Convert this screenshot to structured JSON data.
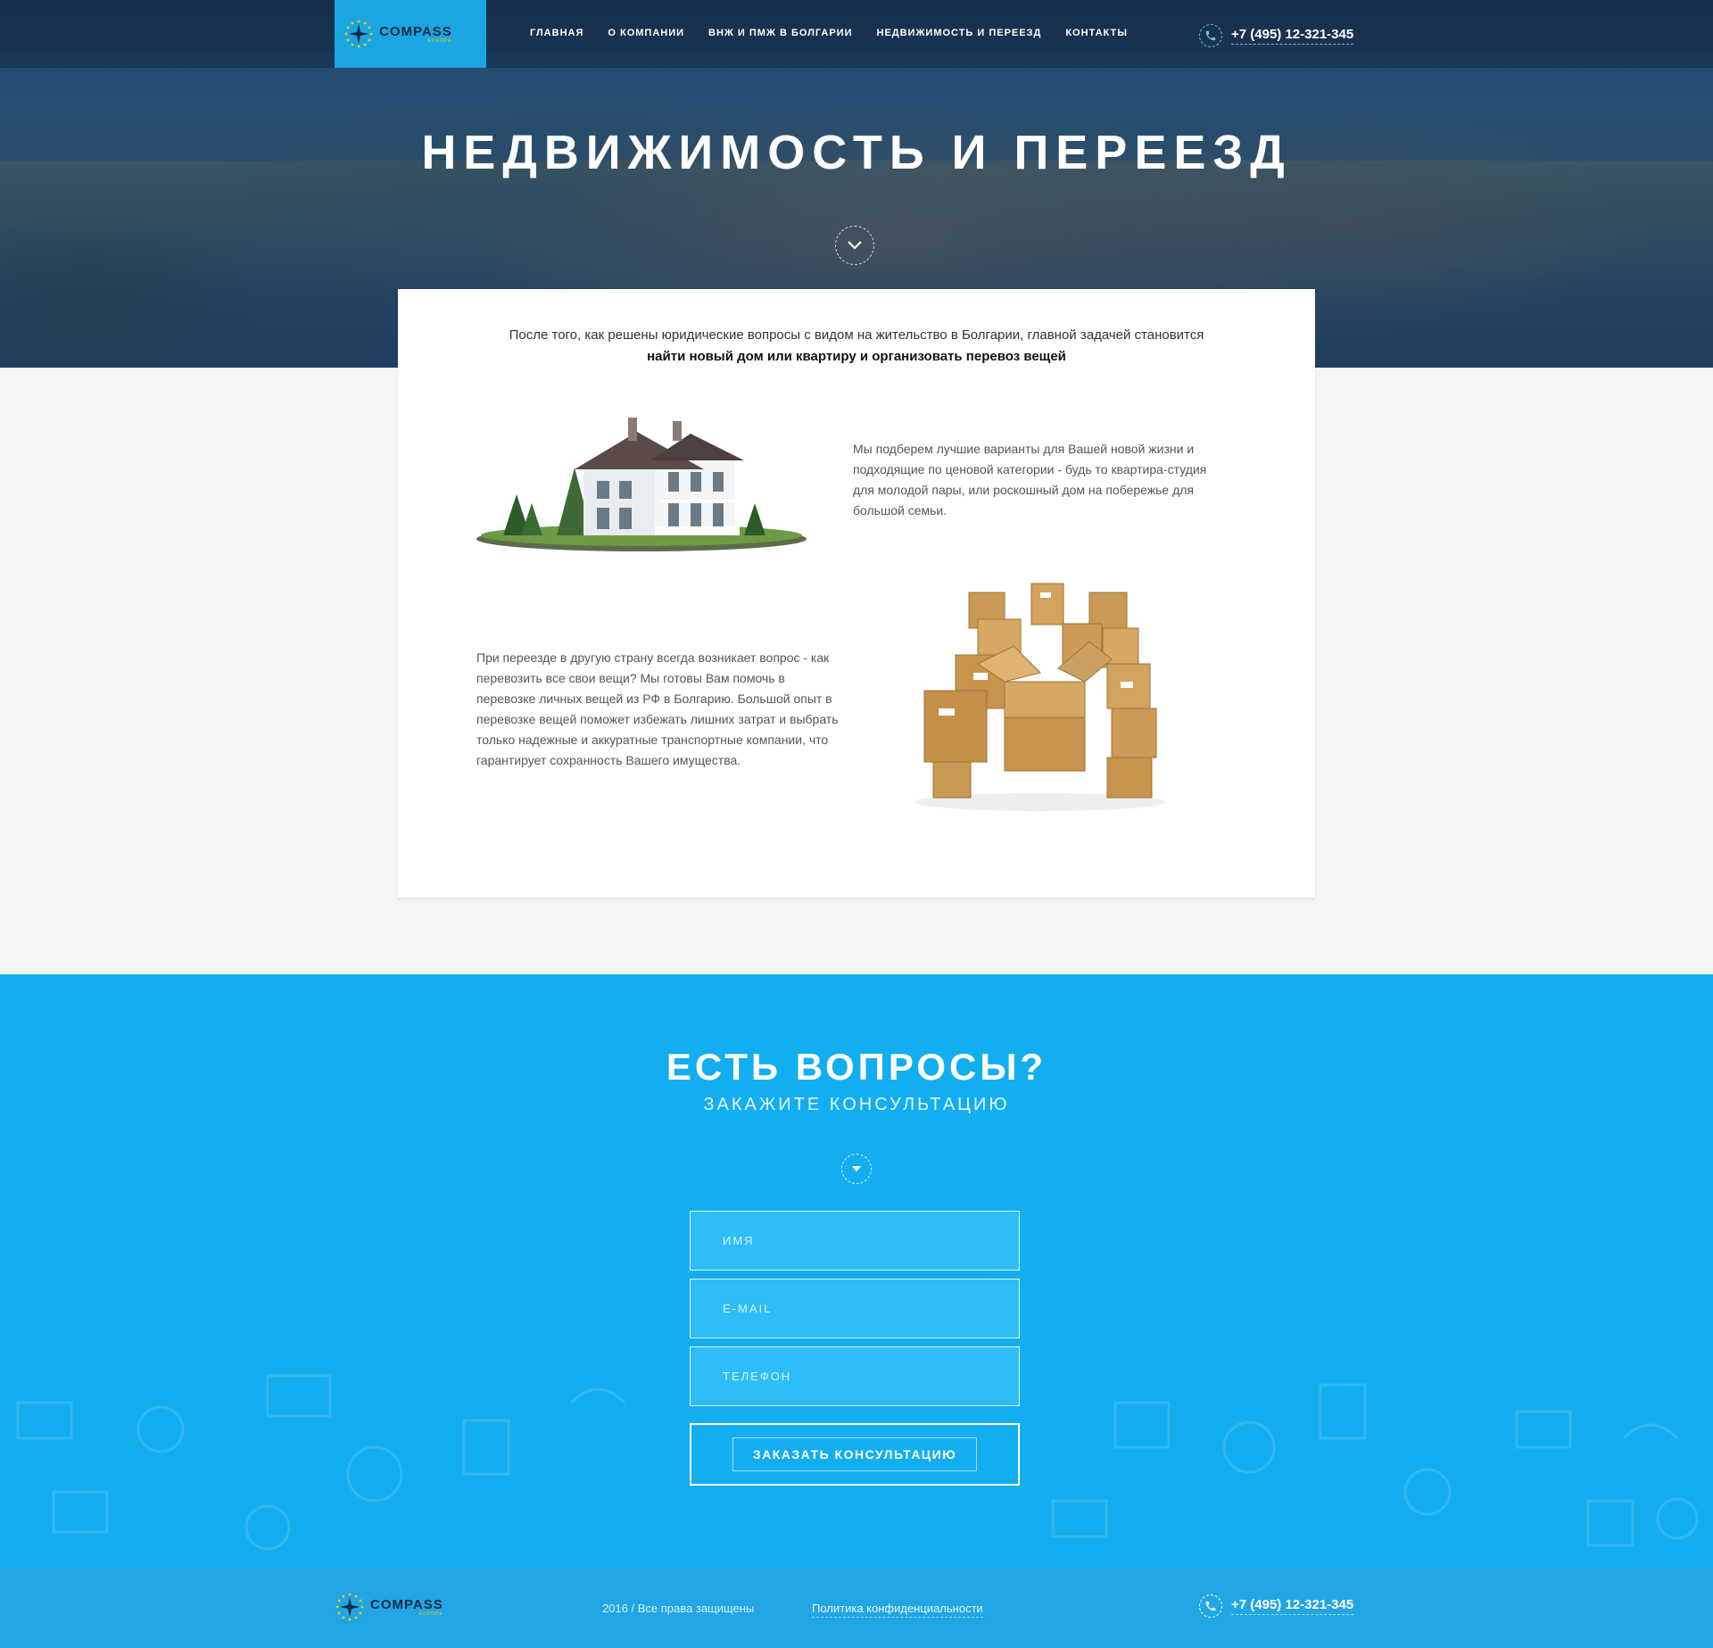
{
  "brand": {
    "name": "COMPASS",
    "sub": "EUROPE",
    "color": "#1aa6e3"
  },
  "nav": {
    "items": [
      {
        "label": "ГЛАВНАЯ"
      },
      {
        "label": "О КОМПАНИИ"
      },
      {
        "label": "ВНЖ И ПМЖ В БОЛГАРИИ"
      },
      {
        "label": "НЕДВИЖИМОСТЬ И ПЕРЕЕЗД"
      },
      {
        "label": "КОНТАКТЫ"
      }
    ]
  },
  "phone": {
    "number": "+7 (495) 12-321-345",
    "icon": "phone-icon"
  },
  "hero": {
    "title": "НЕДВИЖИМОСТЬ И ПЕРЕЕЗД",
    "scroll_icon": "chevron-down-icon"
  },
  "intro": {
    "line1": "После того, как решены юридические вопросы с видом на жительство в Болгарии, главной задачей становится",
    "line2": "найти новый дом или квартиру и организовать перевоз вещей"
  },
  "feature_house": {
    "text": "Мы подберем лучшие варианты для Вашей новой жизни и подходящие по ценовой категории - будь то квартира-студия для молодой пары, или роскошный дом на побережье для большой семьи."
  },
  "feature_moving": {
    "text": "При переезде в другую страну всегда возникает вопрос - как перевозить все свои вещи? Мы готовы Вам помочь в перевозке личных вещей из РФ в Болгарию. Большой опыт в перевозке вещей поможет избежать лишних затрат и выбрать только надежные и аккуратные транспортные компании, что гарантирует сохранность Вашего имущества."
  },
  "consult": {
    "title": "ЕСТЬ ВОПРОСЫ?",
    "subtitle": "ЗАКАЖИТЕ КОНСУЛЬТАЦИЮ",
    "fields": {
      "name": "ИМЯ",
      "email": "E-MAIL",
      "phone": "ТЕЛЕФОН"
    },
    "submit": "ЗАКАЗАТЬ КОНСУЛЬТАЦИЮ",
    "bg_color": "#13aef0"
  },
  "footer": {
    "copyright": "2016 / Все права защищены",
    "privacy": "Политика конфиденциальности",
    "phone": "+7 (495) 12-321-345"
  }
}
